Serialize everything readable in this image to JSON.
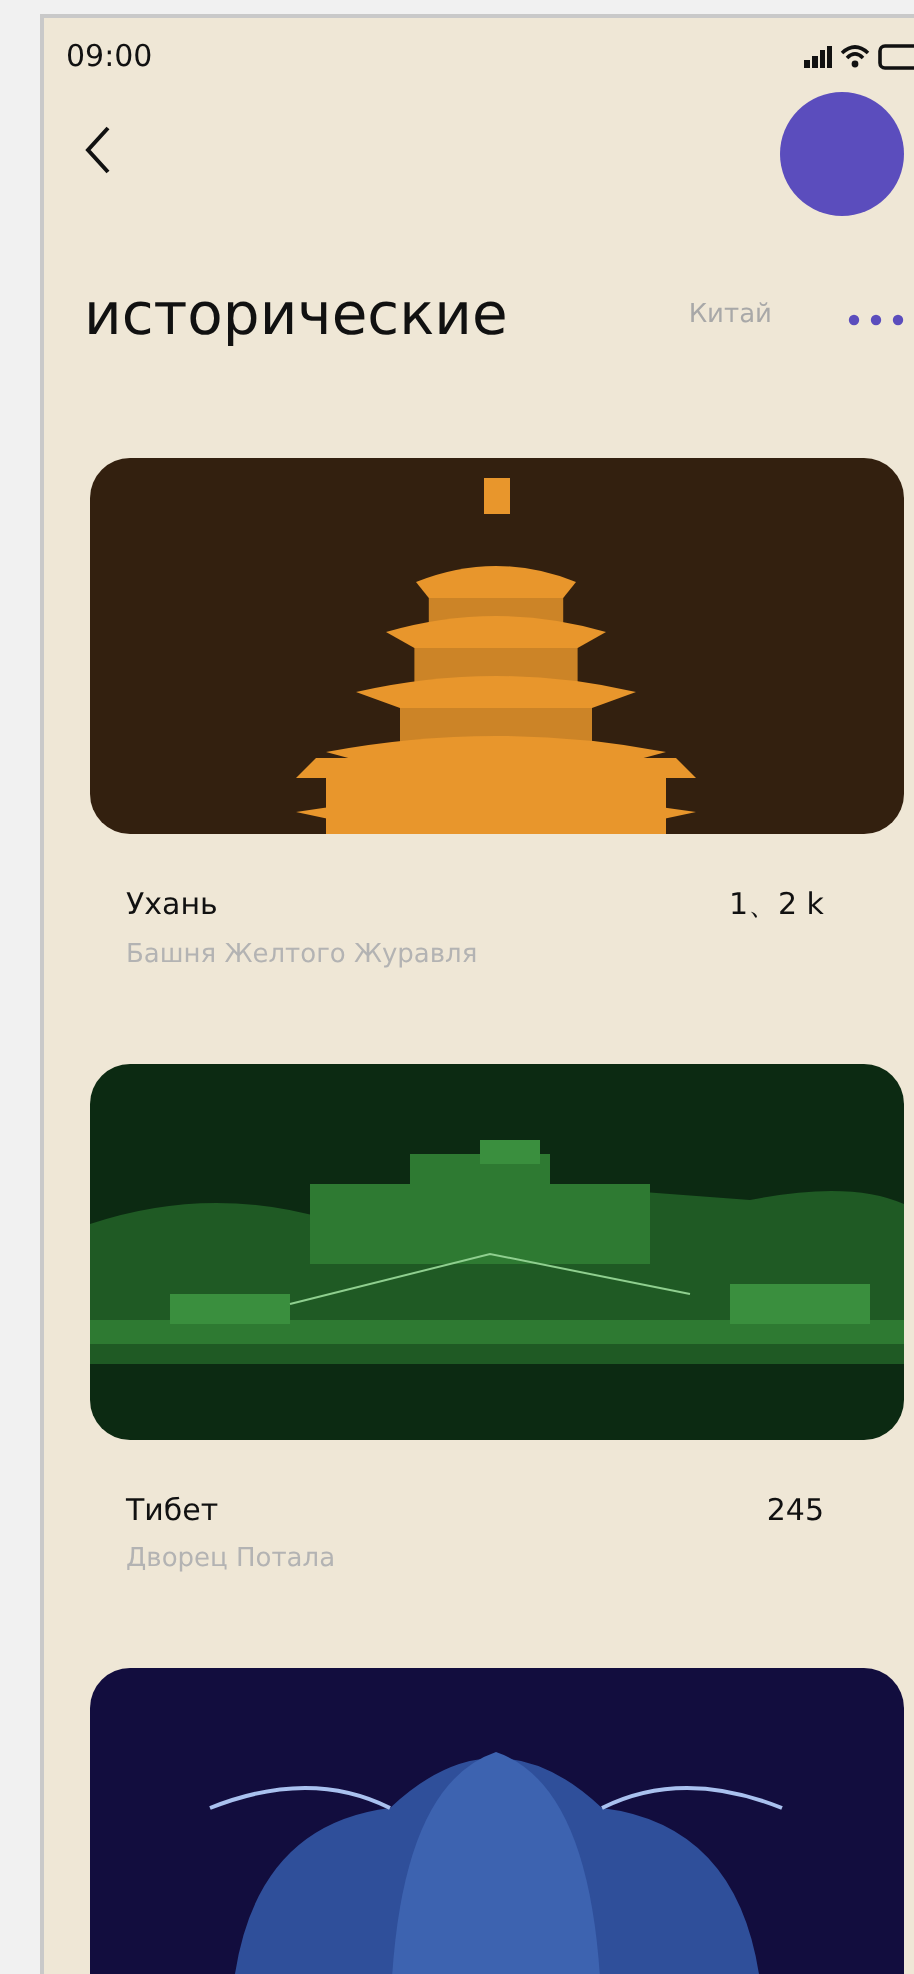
{
  "status_bar": {
    "time": "09:00"
  },
  "header": {
    "title": "исторические",
    "filter": "Китай"
  },
  "places": [
    {
      "image": {
        "kind": "pagoda"
      },
      "name": "Ухань",
      "subtitle": "Башня Желтого Журавля",
      "count": "1、2 k"
    },
    {
      "image": {
        "kind": "palace"
      },
      "name": "Тибет",
      "subtitle": "Дворец Потала",
      "count": "245"
    },
    {
      "image": {
        "kind": "dome"
      }
    }
  ]
}
